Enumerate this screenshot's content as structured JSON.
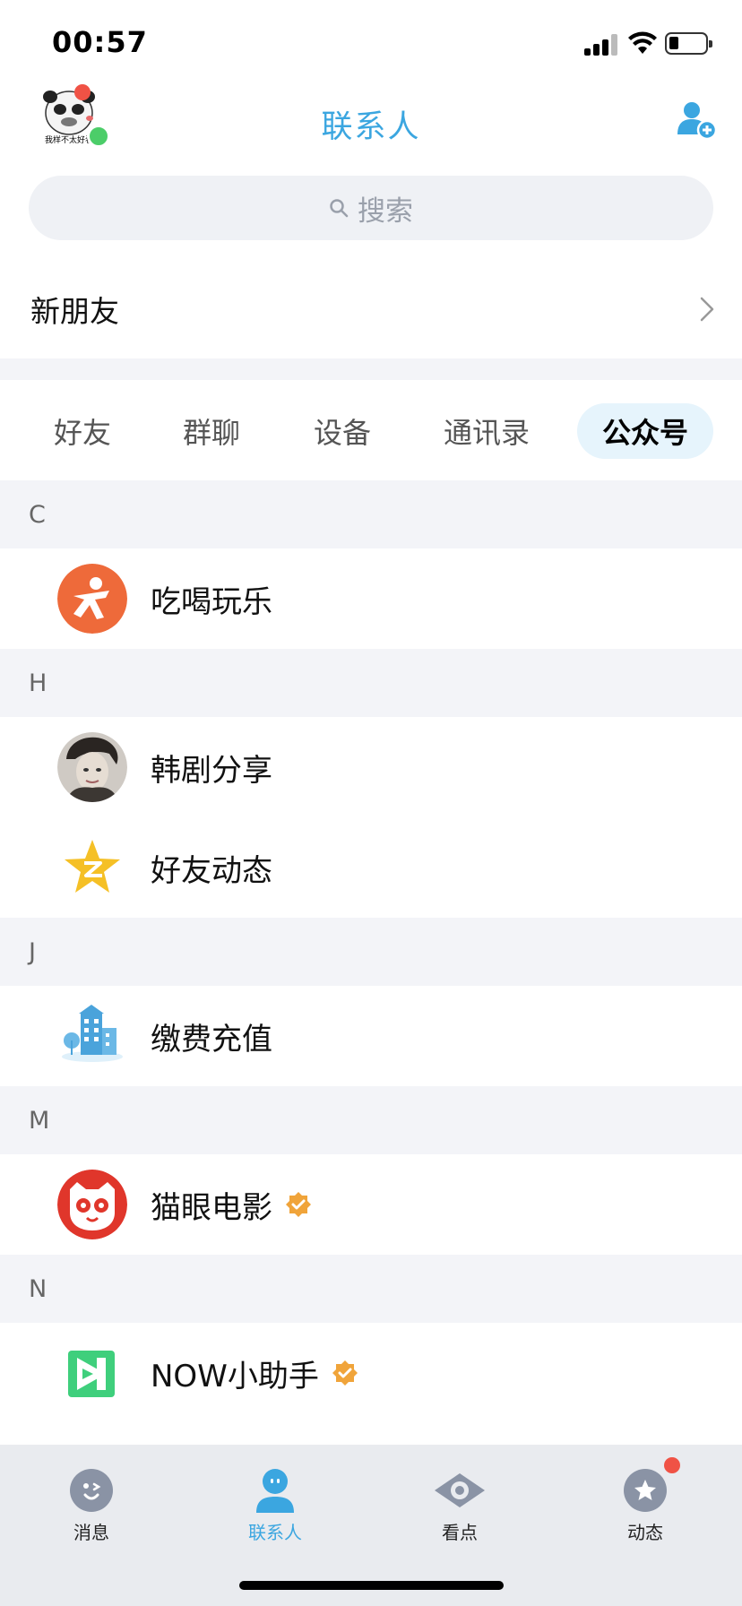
{
  "status_bar": {
    "time": "00:57"
  },
  "header": {
    "avatar_caption": "我样不太好看",
    "title": "联系人"
  },
  "search": {
    "placeholder": "搜索"
  },
  "new_friends": {
    "label": "新朋友"
  },
  "tabs": [
    {
      "label": "好友",
      "active": false
    },
    {
      "label": "群聊",
      "active": false
    },
    {
      "label": "设备",
      "active": false
    },
    {
      "label": "通讯录",
      "active": false
    },
    {
      "label": "公众号",
      "active": true
    }
  ],
  "sections": [
    {
      "letter": "C",
      "items": [
        {
          "name": "吃喝玩乐",
          "icon": "dianping-icon",
          "verified": false
        }
      ]
    },
    {
      "letter": "H",
      "items": [
        {
          "name": "韩剧分享",
          "icon": "portrait-avatar",
          "verified": false
        },
        {
          "name": "好友动态",
          "icon": "qzone-star-icon",
          "verified": false
        }
      ]
    },
    {
      "letter": "J",
      "items": [
        {
          "name": "缴费充值",
          "icon": "building-icon",
          "verified": false
        }
      ]
    },
    {
      "letter": "M",
      "items": [
        {
          "name": "猫眼电影",
          "icon": "maoyan-cat-icon",
          "verified": true
        }
      ]
    },
    {
      "letter": "N",
      "items": [
        {
          "name": "NOW小助手",
          "icon": "now-logo-icon",
          "verified": true
        }
      ]
    }
  ],
  "tabbar": [
    {
      "label": "消息",
      "icon": "message-icon",
      "active": false
    },
    {
      "label": "联系人",
      "icon": "contacts-icon",
      "active": true
    },
    {
      "label": "看点",
      "icon": "eye-icon",
      "active": false
    },
    {
      "label": "动态",
      "icon": "star-feed-icon",
      "active": false,
      "badge": true
    }
  ],
  "colors": {
    "accent": "#3ba6e0",
    "badge": "#f05245",
    "verified": "#f0a43a",
    "section_bg": "#f3f4f8"
  }
}
